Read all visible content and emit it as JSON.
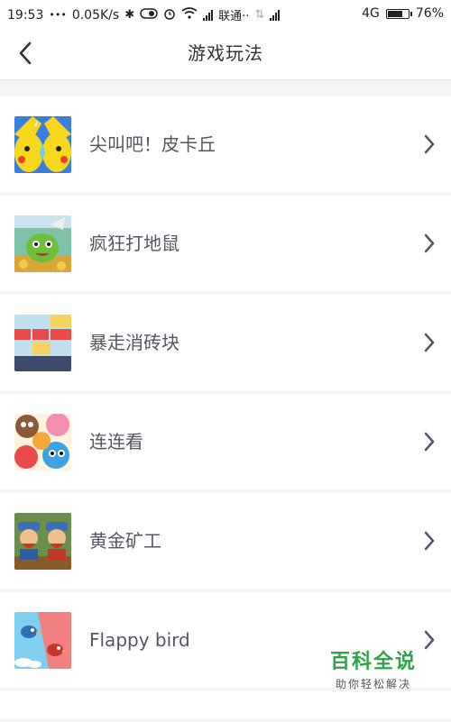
{
  "status_bar": {
    "time": "19:53",
    "dots": "•••",
    "speed": "0.05K/s",
    "carrier": "联通··",
    "network": "4G",
    "battery": "76%",
    "battery_level": 0.76
  },
  "header": {
    "back_icon": "chevron-left-icon",
    "title": "游戏玩法"
  },
  "games": [
    {
      "label": "尖叫吧！皮卡丘",
      "thumb": "pikachu-thumbnail"
    },
    {
      "label": "疯狂打地鼠",
      "thumb": "whack-a-mole-thumbnail"
    },
    {
      "label": "暴走消砖块",
      "thumb": "brick-breaker-thumbnail"
    },
    {
      "label": "连连看",
      "thumb": "link-match-thumbnail"
    },
    {
      "label": "黄金矿工",
      "thumb": "gold-miner-thumbnail"
    },
    {
      "label": "Flappy bird",
      "thumb": "flappy-bird-thumbnail"
    }
  ],
  "watermark": {
    "title": "百科全说",
    "subtitle": "助你轻松解决"
  },
  "colors": {
    "background": "#f5f5f8",
    "label": "#555566",
    "chevron": "#55556a",
    "watermark": "#2fa24a"
  }
}
